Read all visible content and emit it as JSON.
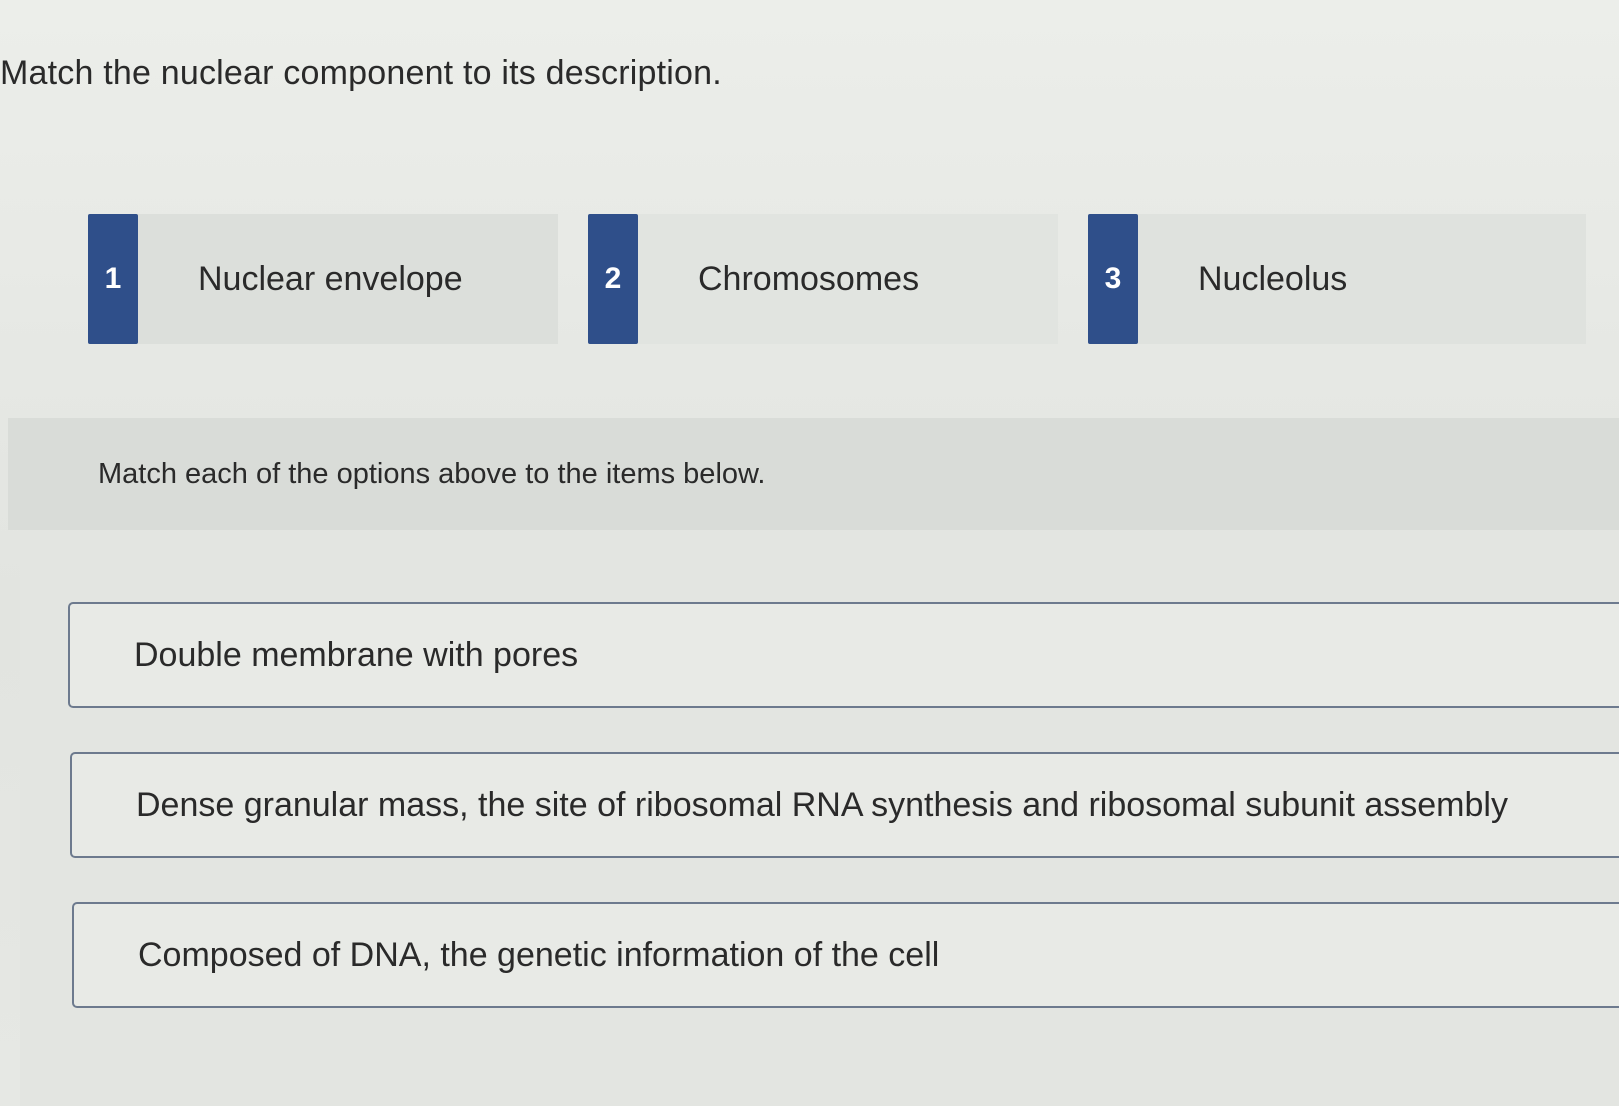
{
  "question": {
    "title": "Match the nuclear component to its description."
  },
  "options": [
    {
      "number": "1",
      "label": "Nuclear envelope"
    },
    {
      "number": "2",
      "label": "Chromosomes"
    },
    {
      "number": "3",
      "label": "Nucleolus"
    }
  ],
  "instructions": "Match each of the options above to the items below.",
  "items": [
    {
      "text": "Double membrane with pores"
    },
    {
      "text": "Dense granular mass, the site of ribosomal RNA synthesis and ribosomal subunit assembly"
    },
    {
      "text": "Composed of DNA, the genetic information of the cell"
    }
  ],
  "colors": {
    "badge": "#2f4f8a",
    "item_border": "#6d7a8e"
  }
}
